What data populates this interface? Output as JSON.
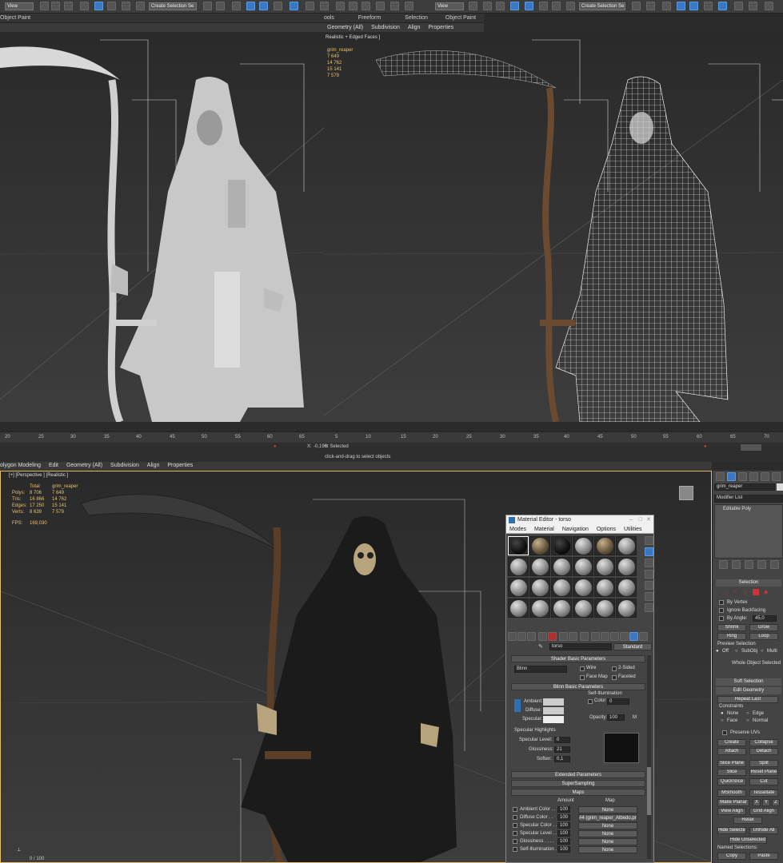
{
  "toolbar": {
    "view_dropdown": "View",
    "selection_set": "Create Selection Se",
    "view_dropdown_right": "View",
    "selection_set_right": "Create Selection Se"
  },
  "ribbon_top_left": {
    "object_paint": "Object Paint"
  },
  "ribbon_top_right": {
    "tabs": [
      "ools",
      "Freeform",
      "Selection",
      "Object Paint"
    ],
    "sub": [
      "Geometry (All)",
      "Subdivision",
      "Align",
      "Properties"
    ]
  },
  "viewport_top_right": {
    "label": "Realistic + Edged Faces ]",
    "stats": [
      "grim_reaper",
      "7 649",
      "14 762",
      "15 141",
      "7 579"
    ]
  },
  "timeline_top": {
    "left_ticks": [
      "20",
      "25",
      "30",
      "35",
      "40",
      "45",
      "50",
      "55",
      "60",
      "65"
    ],
    "right_ticks": [
      "5",
      "10",
      "15",
      "20",
      "25",
      "30",
      "35",
      "40",
      "45",
      "50",
      "55",
      "60",
      "65",
      "70"
    ],
    "status_left": "ct Selected",
    "status_right": "click-and-drag to select objects",
    "x_label": "X:",
    "x_value": "-0,196"
  },
  "ribbon_bottom": {
    "items": [
      "olygon Modeling",
      "Edit",
      "Geometry (All)",
      "Subdivision",
      "Align",
      "Properties"
    ]
  },
  "viewport_bottom": {
    "label": "[+] [Perspective ] [Realistic ]",
    "stats_header": [
      "Total",
      "grim_reaper"
    ],
    "stats_rows": [
      {
        "k": "Polys:",
        "total": "8 706",
        "obj": "7 649"
      },
      {
        "k": "Tris:",
        "total": "16 866",
        "obj": "14 762"
      },
      {
        "k": "Edges:",
        "total": "17 250",
        "obj": "15 141"
      },
      {
        "k": "Verts:",
        "total": "8 639",
        "obj": "7 579"
      }
    ],
    "fps_label": "FPS:",
    "fps_value": "169,030",
    "frame_counter": "0 / 100"
  },
  "material_editor": {
    "title": "Material Editor - torso",
    "menu": [
      "Modes",
      "Material",
      "Navigation",
      "Options",
      "Utilities"
    ],
    "material_name": "torso",
    "material_type": "Standard",
    "shader_rollout": "Shader Basic Parameters",
    "shader": "Blinn",
    "wire": "Wire",
    "two_sided": "2-Sided",
    "face_map": "Face Map",
    "faceted": "Faceted",
    "blinn_rollout": "Blinn Basic Parameters",
    "self_illum": "Self-Illumination",
    "color_label": "Color",
    "color_value": "0",
    "ambient": "Ambient:",
    "diffuse": "Diffuse:",
    "specular": "Specular:",
    "opacity_label": "Opacity:",
    "opacity_value": "100",
    "m": "M",
    "spec_highlights": "Specular Highlights",
    "spec_level": "Specular Level:",
    "spec_level_value": "0",
    "glossiness": "Glossiness:",
    "glossiness_value": "21",
    "soften": "Soften:",
    "soften_value": "0,1",
    "extended": "Extended Parameters",
    "supersampling": "SuperSampling",
    "maps": "Maps",
    "amount_header": "Amount",
    "map_header": "Map",
    "map_rows": [
      {
        "name": "Ambient Color . .",
        "amount": "100",
        "map": "None"
      },
      {
        "name": "Diffuse Color . .",
        "amount": "100",
        "map": "#4 (grim_reaper_Albedo.png)"
      },
      {
        "name": "Specular Color . .",
        "amount": "100",
        "map": "None"
      },
      {
        "name": "Specular Level . .",
        "amount": "100",
        "map": "None"
      },
      {
        "name": "Glossiness . . . .",
        "amount": "100",
        "map": "None"
      },
      {
        "name": "Self-Illumination .",
        "amount": "100",
        "map": "None"
      }
    ]
  },
  "command_panel": {
    "object_name": "grim_reaper",
    "modifier_list": "Modifier List",
    "stack_item": "Editable Poly",
    "selection": "Selection",
    "by_vertex": "By Vertex",
    "ignore_backfacing": "Ignore Backfacing",
    "by_angle": "By Angle:",
    "by_angle_value": "45,0",
    "shrink": "Shrink",
    "grow": "Grow",
    "ring": "Ring",
    "loop": "Loop",
    "preview_selection": "Preview Selection",
    "off": "Off",
    "subobj": "SubObj",
    "multi": "Multi",
    "whole_object_selected": "Whole Object Selected",
    "soft_selection": "Soft Selection",
    "edit_geometry": "Edit Geometry",
    "repeat_last": "Repeat Last",
    "constraints": "Constraints",
    "none": "None",
    "edge": "Edge",
    "face": "Face",
    "normal": "Normal",
    "preserve_uvs": "Preserve UVs",
    "create": "Create",
    "collapse": "Collapse",
    "attach": "Attach",
    "detach": "Detach",
    "slice_plane": "Slice Plane",
    "split": "Split",
    "slice": "Slice",
    "reset_plane": "Reset Plane",
    "quickslice": "QuickSlice",
    "cut": "Cut",
    "msmooth": "MSmooth",
    "tessellate": "Tessellate",
    "make_planar": "Make Planar",
    "x": "X",
    "y": "Y",
    "z": "Z",
    "view_align": "View Align",
    "grid_align": "Grid Align",
    "relax": "Relax",
    "hide_selected": "Hide Selected",
    "unhide_all": "Unhide All",
    "hide_unselected": "Hide Unselected",
    "named_selections": "Named Selections:",
    "copy": "Copy",
    "paste": "Paste"
  }
}
